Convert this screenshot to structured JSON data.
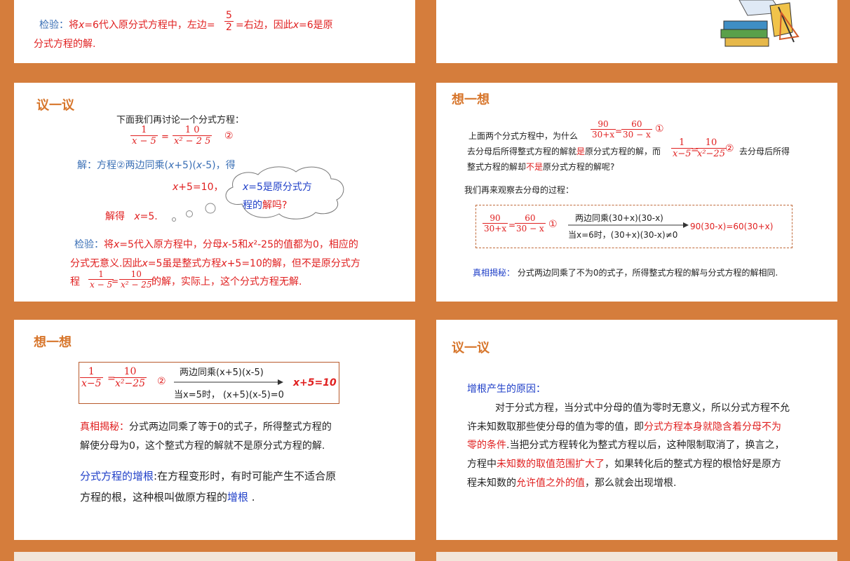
{
  "s1": {
    "check_label": "检验：",
    "check_a": "将",
    "x": "x",
    "check_b": "=6代入原分式方程中，左边=",
    "frac_n": "5",
    "frac_d": "2",
    "check_c": "=右边，因此",
    "check_d": "=6是原",
    "line2": "分式方程的解."
  },
  "s3": {
    "title": "议一议",
    "intro": "下面我们再讨论一个分式方程：",
    "eq_ln": "1",
    "eq_ld": "x − 5",
    "eq_eq": "=",
    "eq_rn": "1 0",
    "eq_rd": "x² − 2 5",
    "circ2": "②",
    "sol": "解：方程②两边同乘(",
    "sol_b": "+5)(",
    "sol_c": "-5)，得",
    "step": "+5=10，",
    "solve": "解得",
    "solve_b": "=5.",
    "bubble_a": "=5是原分式方",
    "bubble_b": "程的",
    "bubble_c": "解吗?",
    "chk_label": "检验：",
    "chk_a": "将",
    "chk_b": "=5代入原方程中，分母",
    "chk_c": "-5和",
    "chk_d": "²-25的值都为0，相应的",
    "chk2_a": "分式无意义.因此",
    "chk2_b": "=5虽是整式方程",
    "chk2_c": "+5=10的解，但不是原分式方",
    "chk3_a": "程",
    "chk3_b": "的解，实际上，这个分式方程无解."
  },
  "s4": {
    "title": "想一想",
    "p1": "上面两个分式方程中，为什么",
    "f1_ln": "90",
    "f1_ld": "30+x",
    "f1_rn": "60",
    "f1_rd": "30 − x",
    "circ1": "①",
    "p2a": "去分母后所得整式方程的解就",
    "p2b": "是",
    "p2c": "原分式方程的解，而",
    "f2_ln": "1",
    "f2_ld": "x−5",
    "f2_rn": "10",
    "f2_rd": "x²−25",
    "circ2": "②",
    "p2d": "去分母后所得",
    "p3a": "整式方程的解却",
    "p3b": "不是",
    "p3c": "原分式方程的解呢?",
    "p4": "我们再来观察去分母的过程：",
    "arrow_top": "两边同乘(30+x)(30-x)",
    "arrow_bot": "当x=6时，(30+x)(30-x)≠0",
    "result": "90(30-x)=60(30+x)",
    "truth_label": "真相揭秘：",
    "truth": "分式两边同乘了不为0的式子，所得整式方程的解与分式方程的解相同."
  },
  "s5": {
    "title": "想一想",
    "arrow_top": "两边同乘(x+5)(x-5)",
    "arrow_bot": "当x=5时，  (x+5)(x-5)=0",
    "result": "x+5=10",
    "truth_label": "真相揭秘：",
    "truth1": "分式两边同乘了等于0的式子，所得整式方程的",
    "truth2": "解使分母为0，这个整式方程的解就不是原分式方程的解.",
    "def_term": "分式方程的增根",
    "def1": ":在方程变形时，有时可能产生不适合原",
    "def2": "方程的根，这种根叫做原方程的",
    "def_term2": "增根",
    "def_end": " ."
  },
  "s6": {
    "title": "议一议",
    "reason": "增根产生的原因：",
    "l1": "对于分式方程，当分式中分母的值为零时无意义，所以分式方程不允",
    "l2a": "许未知数取那些使分母的值为零的值，即",
    "l2b": "分式方程本身就隐含着分母不为",
    "l3a": "零的条件",
    "l3b": ".当把分式方程转化为整式方程以后，这种限制取消了，换言之，",
    "l4a": "方程中",
    "l4b": "未知数的取值范围扩大了",
    "l4c": "，如果转化后的整式方程的根恰好是原方",
    "l5a": "程未知数的",
    "l5b": "允许值之外的值",
    "l5c": "，那么就会出现增根."
  },
  "colors": {
    "frame": "#d57d3c",
    "title": "#d7762c",
    "red": "#e02020",
    "blue": "#1f3fc8"
  }
}
